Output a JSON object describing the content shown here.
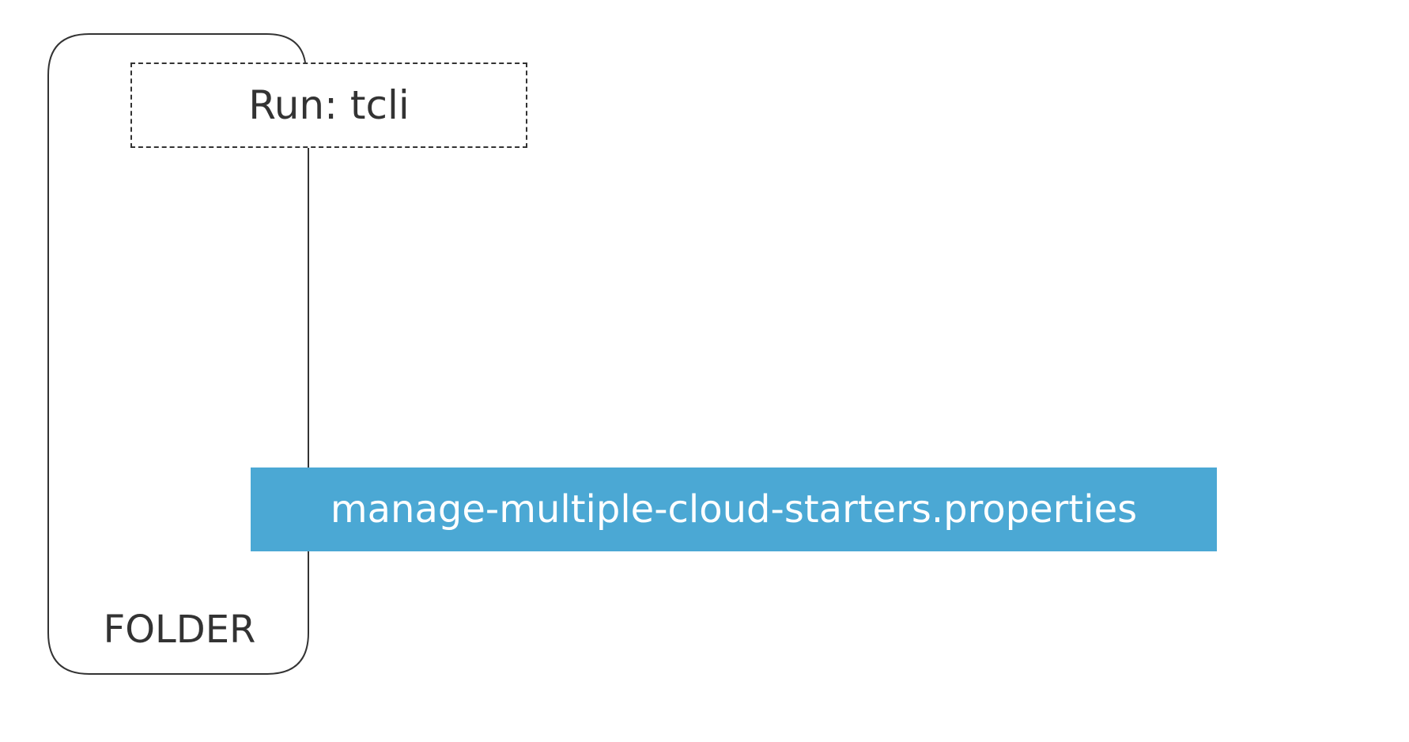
{
  "folder": {
    "label": "FOLDER"
  },
  "run_step": {
    "label": "Run: tcli"
  },
  "file": {
    "label": "manage-multiple-cloud-starters.properties",
    "color": "#4ba8d4"
  },
  "colors": {
    "stroke": "#333333",
    "background": "#ffffff",
    "file_text": "#ffffff"
  }
}
